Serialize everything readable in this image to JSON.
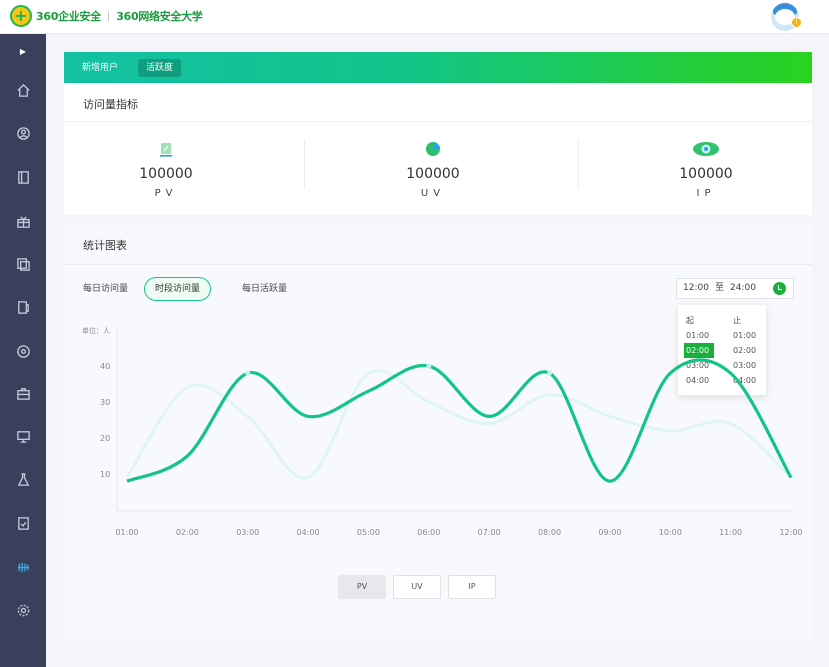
{
  "header": {
    "logo_brand": "360企业安全",
    "logo_divider": "|",
    "logo_university": "360网络安全大学",
    "avatar_badge": "!"
  },
  "sidebar": {
    "toggle_icon": "▶",
    "items": [
      {
        "icon": "home-icon"
      },
      {
        "icon": "user-icon"
      },
      {
        "icon": "book-icon"
      },
      {
        "icon": "gift-icon"
      },
      {
        "icon": "copy-icon"
      },
      {
        "icon": "document-icon"
      },
      {
        "icon": "compass-icon"
      },
      {
        "icon": "briefcase-icon"
      },
      {
        "icon": "monitor-icon"
      },
      {
        "icon": "flask-icon"
      },
      {
        "icon": "checklist-icon"
      },
      {
        "icon": "chart-bars-icon",
        "active": true
      },
      {
        "icon": "gear-icon"
      }
    ]
  },
  "top_tabs": [
    "新增用户",
    "活跃度"
  ],
  "metrics_card": {
    "title": "访问量指标",
    "items": [
      {
        "value": "100000",
        "label": "PV",
        "icon": "pv-icon"
      },
      {
        "value": "100000",
        "label": "UV",
        "icon": "uv-icon"
      },
      {
        "value": "100000",
        "label": "IP",
        "icon": "ip-icon"
      }
    ]
  },
  "chart_card": {
    "title": "统计图表",
    "segments": [
      "每日访问量",
      "时段访问量",
      "每日活跃量"
    ],
    "active_segment": 1,
    "time_range": {
      "start": "12:00",
      "sep": "至",
      "end": "24:00"
    },
    "dropdown": {
      "start_header": "起",
      "end_header": "止",
      "start_options": [
        "01:00",
        "02:00",
        "03:00",
        "04:00"
      ],
      "end_options": [
        "01:00",
        "02:00",
        "03:00",
        "04:00"
      ],
      "selected_start": "02:00"
    },
    "bottom_buttons": [
      "PV",
      "UV",
      "IP"
    ],
    "active_bottom": 0
  },
  "chart_data": {
    "type": "line",
    "unit_label": "单位：人",
    "x": [
      "01:00",
      "02:00",
      "03:00",
      "04:00",
      "05:00",
      "06:00",
      "07:00",
      "08:00",
      "09:00",
      "10:00",
      "11:00",
      "12:00"
    ],
    "ytick_labels": [
      "10",
      "20",
      "30",
      "40"
    ],
    "ylim": [
      0,
      50
    ],
    "series": [
      {
        "values": [
          8,
          15,
          38,
          26,
          33,
          40,
          26,
          38,
          8,
          38,
          38,
          9
        ],
        "color": "#13c48a"
      },
      {
        "values": [
          9,
          34,
          26,
          9,
          38,
          30,
          24,
          32,
          26,
          22,
          24,
          9
        ],
        "color": "#dff5f3"
      }
    ],
    "grid": false
  },
  "colors": {
    "accent": "#13c48a",
    "sidebar": "#3a3f5c",
    "active_icon": "#28b4f0"
  }
}
